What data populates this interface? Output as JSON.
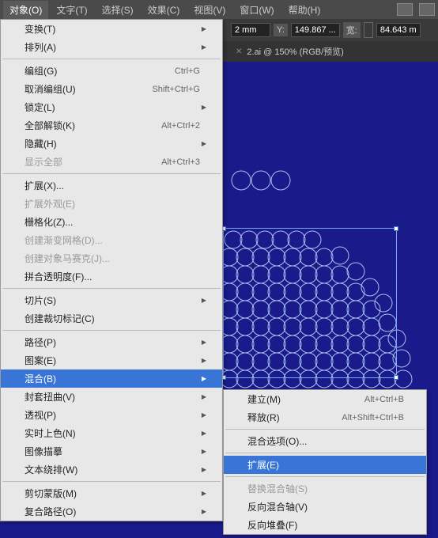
{
  "menubar": {
    "items": [
      "对象(O)",
      "文字(T)",
      "选择(S)",
      "效果(C)",
      "视图(V)",
      "窗口(W)",
      "帮助(H)"
    ]
  },
  "propbar": {
    "x_label": "2 mm",
    "y_label": "Y:",
    "y_val": "149.867 ...",
    "w_label": "宽:",
    "w_val": "84.643 m"
  },
  "tab": {
    "title": "2.ai @ 150% (RGB/预览)"
  },
  "menu": {
    "transform": "变换(T)",
    "arrange": "排列(A)",
    "group": "编组(G)",
    "group_sc": "Ctrl+G",
    "ungroup": "取消编组(U)",
    "ungroup_sc": "Shift+Ctrl+G",
    "lock": "锁定(L)",
    "unlock_all": "全部解锁(K)",
    "unlock_all_sc": "Alt+Ctrl+2",
    "hide": "隐藏(H)",
    "show_all": "显示全部",
    "show_all_sc": "Alt+Ctrl+3",
    "expand": "扩展(X)...",
    "expand_appearance": "扩展外观(E)",
    "rasterize": "栅格化(Z)...",
    "gradient_mesh": "创建渐变网格(D)...",
    "mosaic": "创建对象马赛克(J)...",
    "flatten": "拼合透明度(F)...",
    "slice": "切片(S)",
    "crop_marks": "创建裁切标记(C)",
    "path": "路径(P)",
    "pattern": "图案(E)",
    "blend": "混合(B)",
    "envelope": "封套扭曲(V)",
    "perspective": "透视(P)",
    "live_paint": "实时上色(N)",
    "image_trace": "图像描摹",
    "text_wrap": "文本绕排(W)",
    "clipping_mask": "剪切蒙版(M)",
    "compound_path": "复合路径(O)"
  },
  "submenu": {
    "make": "建立(M)",
    "make_sc": "Alt+Ctrl+B",
    "release": "释放(R)",
    "release_sc": "Alt+Shift+Ctrl+B",
    "options": "混合选项(O)...",
    "expand": "扩展(E)",
    "replace_spine": "替换混合轴(S)",
    "reverse_spine": "反向混合轴(V)",
    "reverse_front": "反向堆叠(F)"
  }
}
